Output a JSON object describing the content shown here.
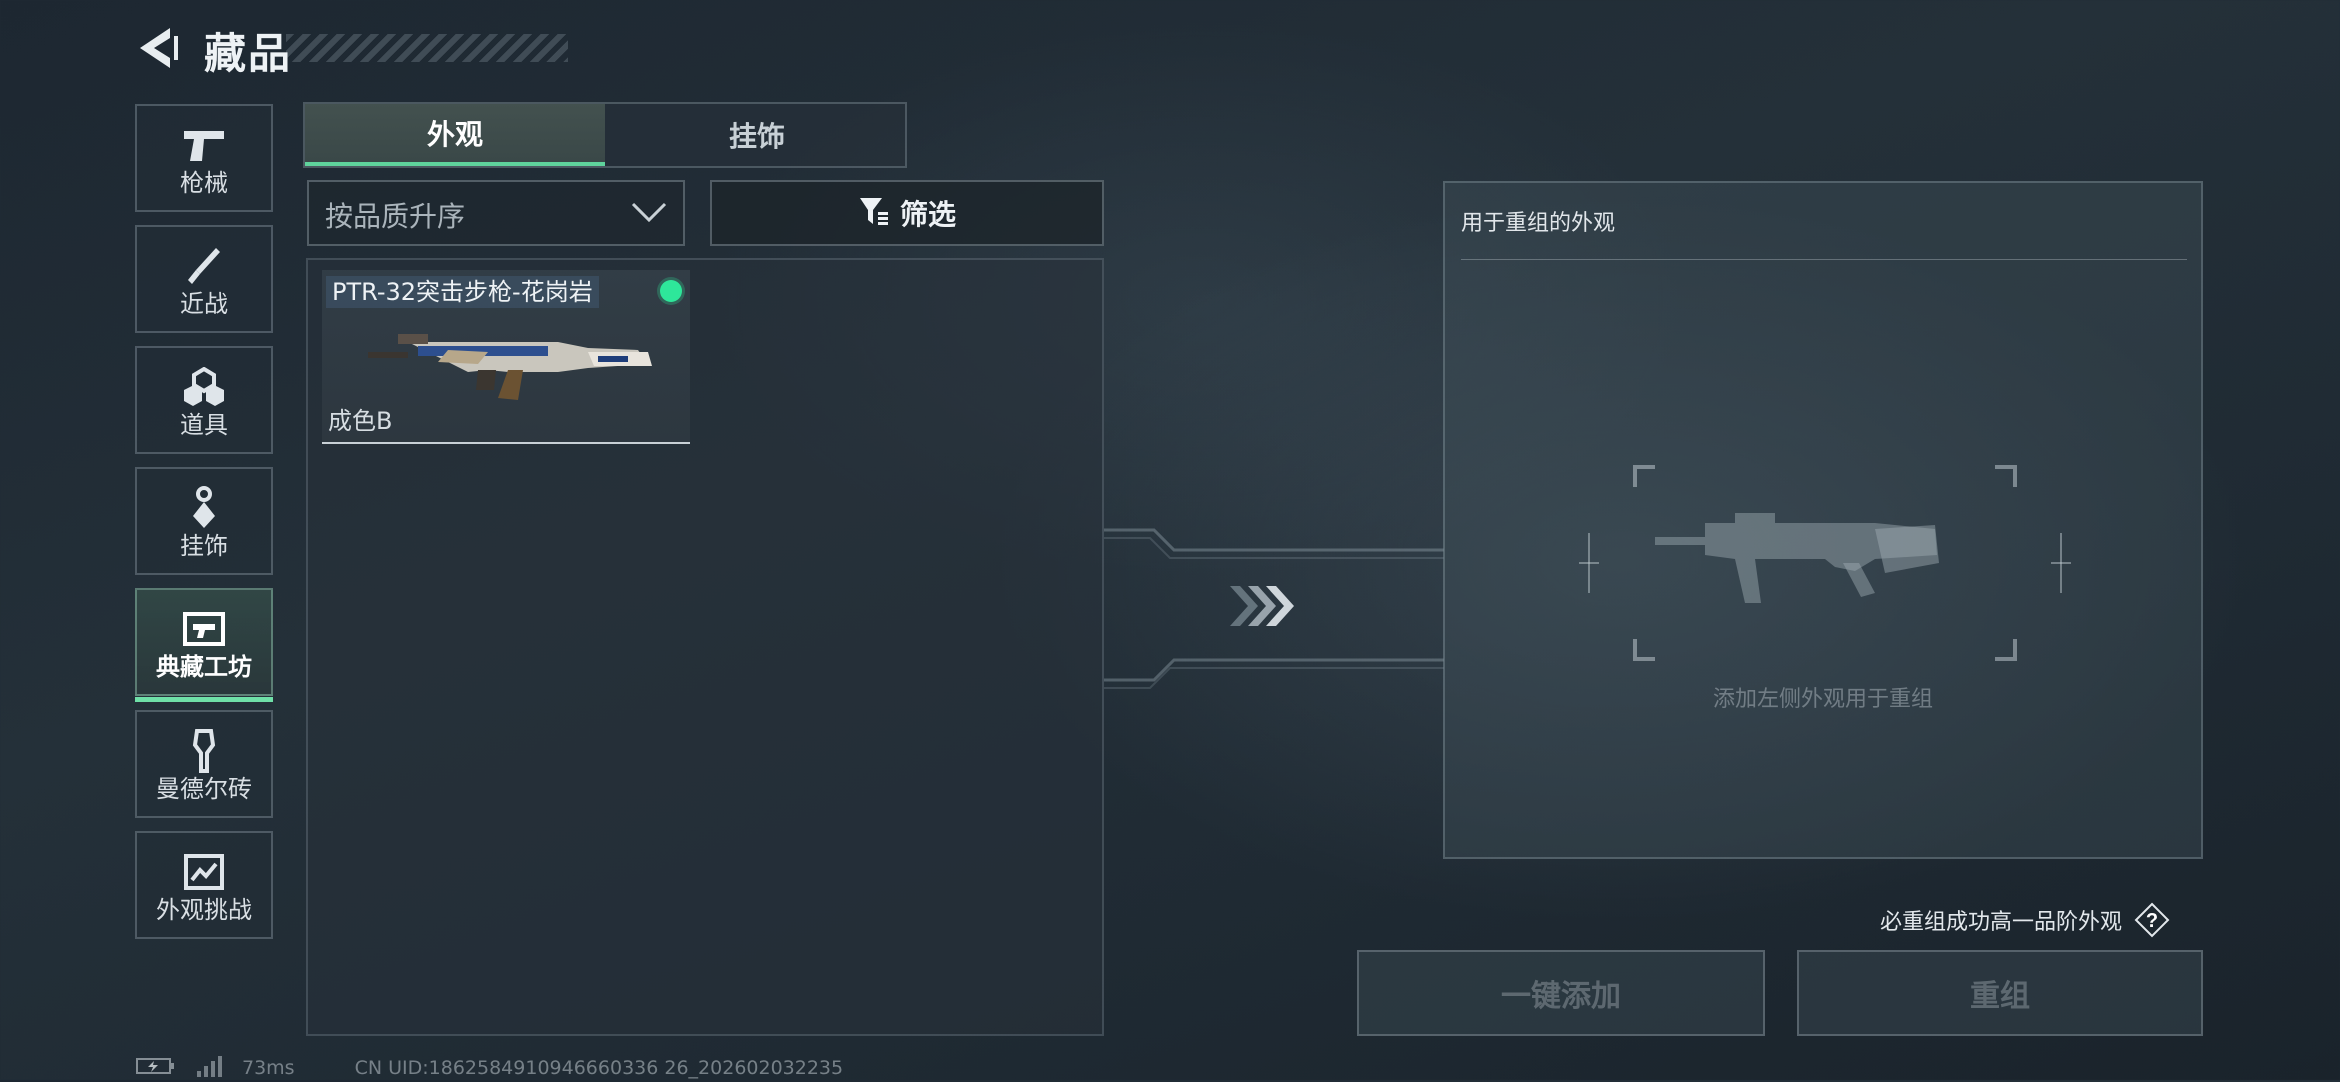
{
  "header": {
    "title": "藏品"
  },
  "sidebar": {
    "items": [
      {
        "label": "枪械",
        "icon": "pistol-icon"
      },
      {
        "label": "近战",
        "icon": "knife-icon"
      },
      {
        "label": "道具",
        "icon": "grenades-icon"
      },
      {
        "label": "挂饰",
        "icon": "charm-icon"
      },
      {
        "label": "典藏工坊",
        "icon": "workshop-icon",
        "active": true
      },
      {
        "label": "曼德尔砖",
        "icon": "brick-icon"
      },
      {
        "label": "外观挑战",
        "icon": "challenge-icon"
      }
    ]
  },
  "tabs": [
    {
      "label": "外观",
      "active": true
    },
    {
      "label": "挂饰",
      "active": false
    }
  ],
  "sort": {
    "selected": "按品质升序"
  },
  "filter": {
    "label": "筛选"
  },
  "items": [
    {
      "name": "PTR-32突击步枪-花岗岩",
      "grade": "成色B",
      "status_color": "#2ee79a"
    }
  ],
  "recast": {
    "title": "用于重组的外观",
    "hint": "添加左侧外观用于重组",
    "note": "必重组成功高一品阶外观",
    "add_all_label": "一键添加",
    "recast_label": "重组"
  },
  "footer": {
    "ping": "73ms",
    "uid": "CN UID:1862584910946660336 26_202602032235"
  },
  "colors": {
    "accent": "#5fd39c",
    "status_dot": "#2ee79a"
  }
}
